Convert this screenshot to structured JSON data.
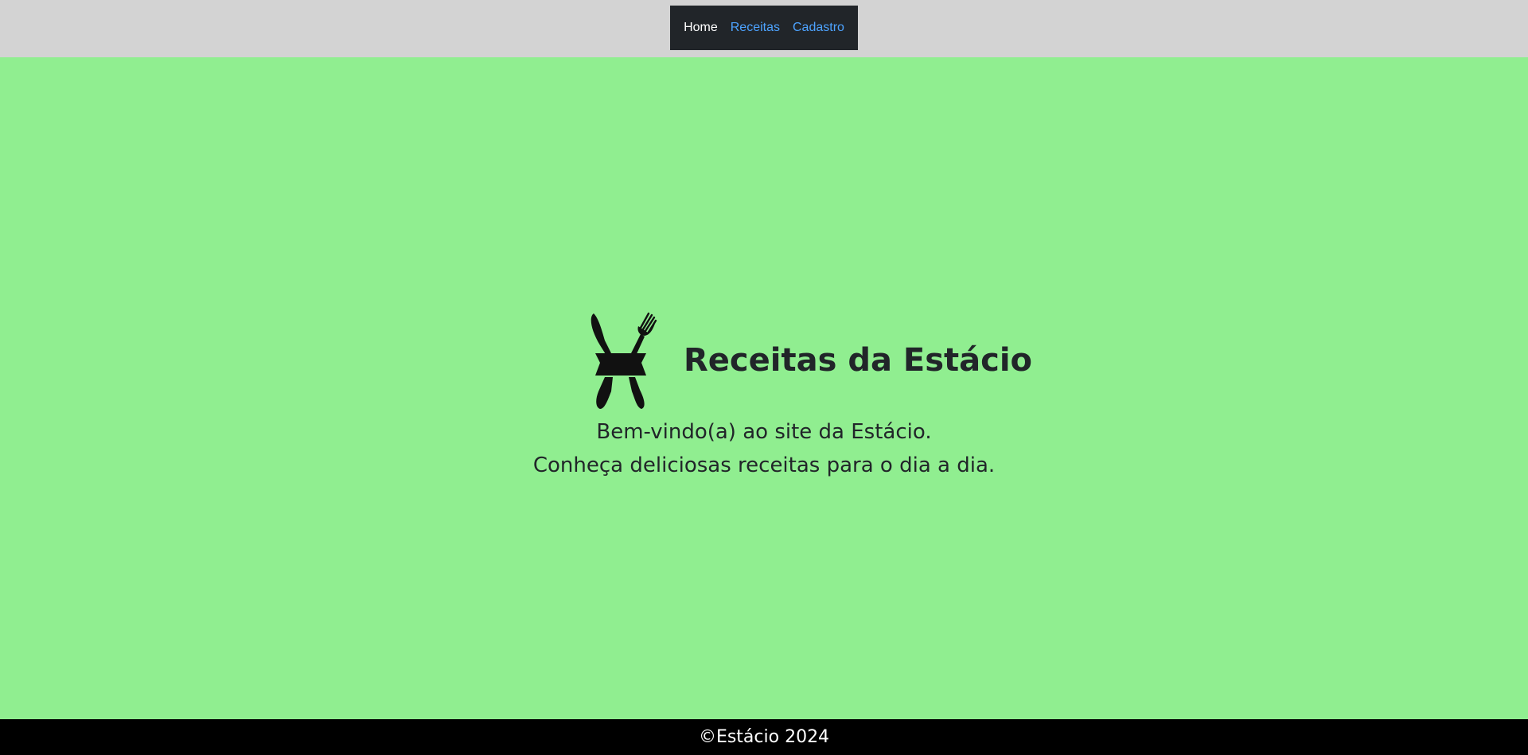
{
  "nav": {
    "items": [
      {
        "label": "Home",
        "active": true
      },
      {
        "label": "Receitas",
        "active": false
      },
      {
        "label": "Cadastro",
        "active": false
      }
    ]
  },
  "hero": {
    "logo_icon": "crossed-knife-fork-banner-icon",
    "title": "Receitas da Estácio",
    "lines": [
      "Bem-vindo(a) ao site da Estácio.",
      "Conheça deliciosas receitas para o dia a dia."
    ]
  },
  "footer": {
    "text": "©Estácio 2024"
  },
  "colors": {
    "page_bg": "#90ee90",
    "topbar_bg": "#d3d3d3",
    "nav_bg": "#212529",
    "link": "#4da3ff",
    "footer_bg": "#000000"
  }
}
